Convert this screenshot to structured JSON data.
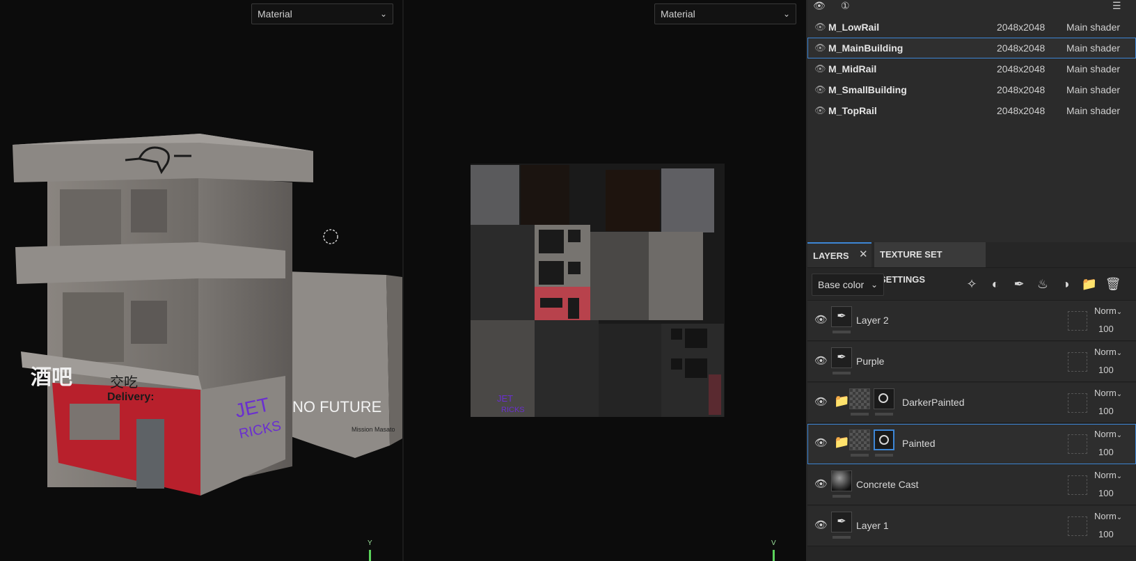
{
  "viewport3d": {
    "mode_dropdown": "Material",
    "axis_label": "Y"
  },
  "viewport2d": {
    "mode_dropdown": "Material",
    "axis_label": "V"
  },
  "building": {
    "sign_left": "酒吧",
    "sign_right": "交吃",
    "sign_delivery": "Delivery:",
    "graffiti_purple_1": "JET",
    "graffiti_purple_2": "RICKS",
    "graffiti_wall": "NO FUTURE",
    "graffiti_small": "Mission Masato"
  },
  "uv_map": {
    "graffiti_1": "JET",
    "graffiti_2": "RICKS"
  },
  "texture_sets": {
    "header_icons": [
      "eye-settings-icon",
      "solo-icon",
      "menu-icon"
    ],
    "rows": [
      {
        "name": "M_LowRail",
        "resolution": "2048x2048",
        "shader": "Main shader",
        "selected": false
      },
      {
        "name": "M_MainBuilding",
        "resolution": "2048x2048",
        "shader": "Main shader",
        "selected": true
      },
      {
        "name": "M_MidRail",
        "resolution": "2048x2048",
        "shader": "Main shader",
        "selected": false
      },
      {
        "name": "M_SmallBuilding",
        "resolution": "2048x2048",
        "shader": "Main shader",
        "selected": false
      },
      {
        "name": "M_TopRail",
        "resolution": "2048x2048",
        "shader": "Main shader",
        "selected": false
      }
    ]
  },
  "layers_panel": {
    "tab_layers": "LAYERS",
    "tab_close": "✕",
    "tab_texture_set_settings": "TEXTURE SET SETTINGS",
    "channel_dropdown": "Base color",
    "toolbar_icons": [
      "add-effect-icon",
      "add-mask-icon",
      "add-paint-layer-icon",
      "add-fill-layer-icon",
      "add-smart-material-icon",
      "add-folder-icon",
      "delete-icon"
    ],
    "layers": [
      {
        "name": "Layer 2",
        "type": "paint",
        "blend": "Norm",
        "opacity": "100",
        "selected": false
      },
      {
        "name": "Purple",
        "type": "paint",
        "blend": "Norm",
        "opacity": "100",
        "selected": false
      },
      {
        "name": "DarkerPainted",
        "type": "folder",
        "blend": "Norm",
        "opacity": "100",
        "selected": false
      },
      {
        "name": "Painted",
        "type": "folder",
        "blend": "Norm",
        "opacity": "100",
        "selected": true
      },
      {
        "name": "Concrete Cast",
        "type": "fill",
        "blend": "Norm",
        "opacity": "100",
        "selected": false
      },
      {
        "name": "Layer 1",
        "type": "paint",
        "blend": "Norm",
        "opacity": "100",
        "selected": false
      }
    ]
  }
}
